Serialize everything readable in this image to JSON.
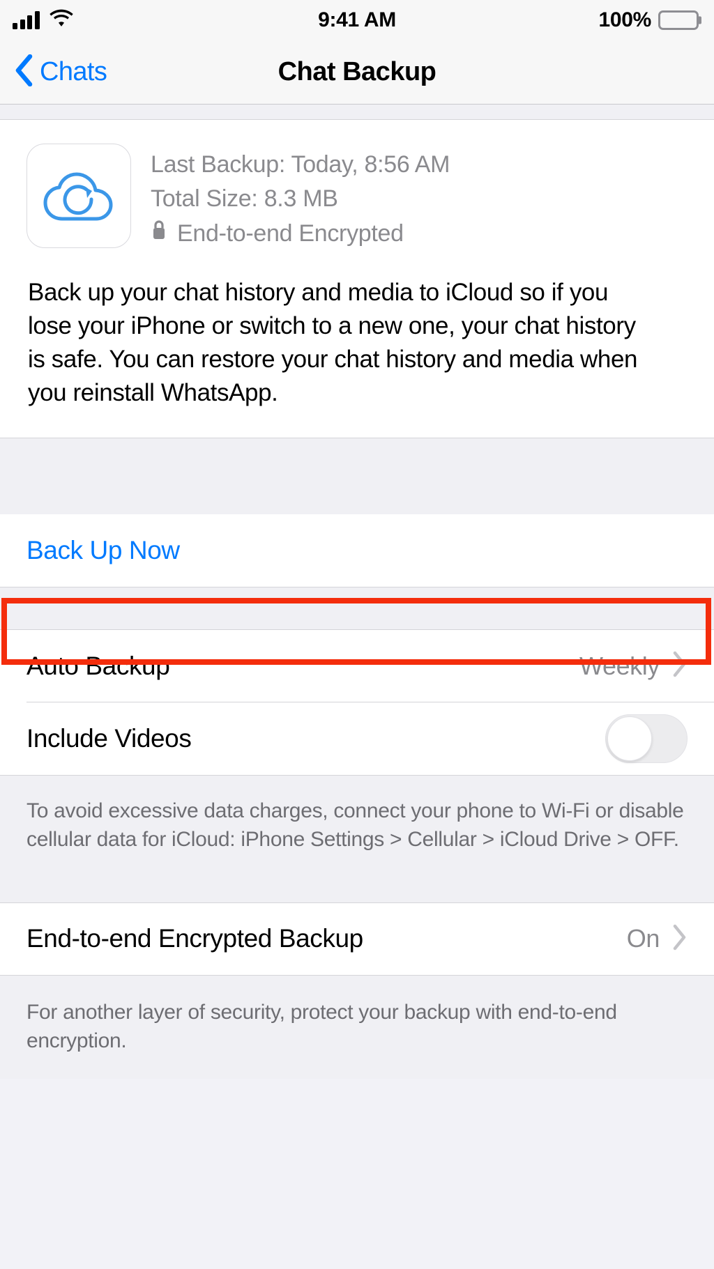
{
  "status_bar": {
    "signal_icon": "cellular-signal-icon",
    "signal_bars": 4,
    "wifi_icon": "wifi-icon",
    "time": "9:41 AM",
    "battery_percent": "100%",
    "battery_icon": "battery-full-icon"
  },
  "nav": {
    "back_icon": "chevron-left-icon",
    "back_label": "Chats",
    "title": "Chat Backup"
  },
  "backup_info": {
    "icon": "cloud-backup-icon",
    "last_backup": "Last Backup: Today, 8:56 AM",
    "total_size": "Total Size: 8.3 MB",
    "lock_icon": "lock-icon",
    "encryption_status": "End-to-end Encrypted",
    "description": "Back up your chat history and media to iCloud so if you lose your iPhone or switch to a new one, your chat history is safe. You can restore your chat history and media when you reinstall WhatsApp."
  },
  "actions": {
    "back_up_now": "Back Up Now",
    "highlight_color": "#f42d0c"
  },
  "settings": {
    "auto_backup": {
      "label": "Auto Backup",
      "value": "Weekly",
      "chevron_icon": "chevron-right-icon"
    },
    "include_videos": {
      "label": "Include Videos",
      "toggle_state": "off"
    },
    "data_footer": "To avoid excessive data charges, connect your phone to Wi-Fi or disable cellular data for iCloud: iPhone Settings > Cellular > iCloud Drive > OFF.",
    "e2e_backup": {
      "label": "End-to-end Encrypted Backup",
      "value": "On",
      "chevron_icon": "chevron-right-icon"
    },
    "e2e_footer": "For another layer of security, protect your backup with end-to-end encryption."
  },
  "colors": {
    "accent_blue": "#007aff",
    "group_bg": "#f0f0f4",
    "secondary_text": "#8a8a8e"
  }
}
